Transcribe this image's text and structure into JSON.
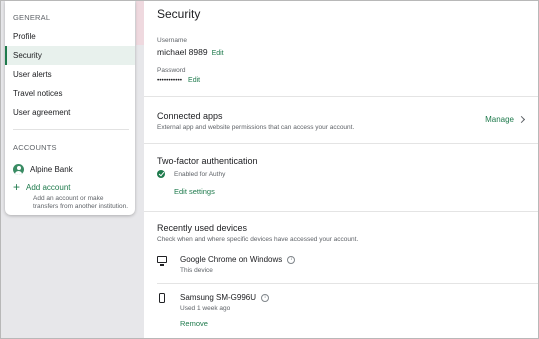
{
  "sidebar": {
    "general_label": "GENERAL",
    "items": [
      {
        "label": "Profile"
      },
      {
        "label": "Security"
      },
      {
        "label": "User alerts"
      },
      {
        "label": "Travel notices"
      },
      {
        "label": "User agreement"
      }
    ],
    "accounts_label": "ACCOUNTS",
    "account_name": "Alpine Bank",
    "add_account_label": "Add account",
    "add_account_desc": "Add an account or make transfers from another institution."
  },
  "main": {
    "title": "Security",
    "username_label": "Username",
    "username_value": "michael 8989",
    "password_label": "Password",
    "password_value": "•••••••••••",
    "edit_label": "Edit",
    "connected_apps": {
      "title": "Connected apps",
      "desc": "External app and website permissions that can access your account.",
      "manage_label": "Manage"
    },
    "two_factor": {
      "title": "Two-factor authentication",
      "status": "Enabled for Authy",
      "edit_settings": "Edit settings"
    },
    "devices": {
      "title": "Recently used devices",
      "desc": "Check when and where specific devices have accessed your account.",
      "list": [
        {
          "name": "Google Chrome on Windows",
          "status": "This device"
        },
        {
          "name": "Samsung SM-G996U",
          "status": "Used 1 week ago",
          "remove_label": "Remove"
        }
      ]
    }
  }
}
